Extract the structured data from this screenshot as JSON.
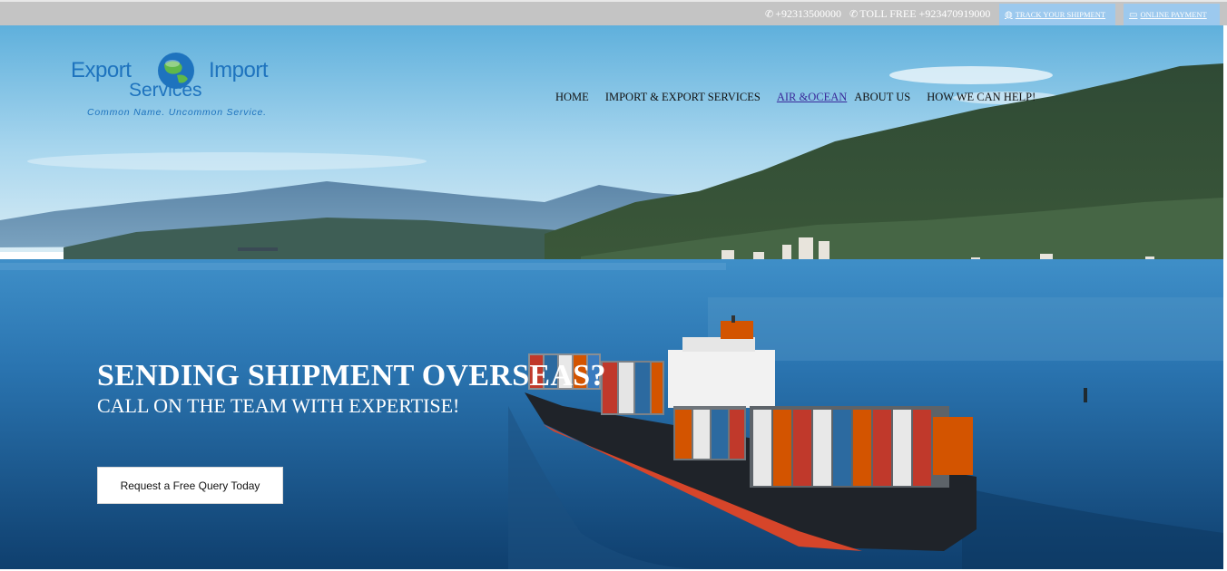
{
  "topbar": {
    "phone1": "+92313500000",
    "phone2": "TOLL FREE +923470919000",
    "track_label": "TRACK YOUR SHIPMENT",
    "payment_label": "ONLINE PAYMENT",
    "bg_color": "#c4c4c4",
    "pill_color": "#9cc9ee"
  },
  "logo": {
    "word1": "Export",
    "word2": "Import",
    "word3": "Services",
    "tagline": "Common Name. Uncommon Service.",
    "brand_color": "#1e73be"
  },
  "nav": {
    "items": [
      {
        "label": "HOME"
      },
      {
        "label": "IMPORT & EXPORT SERVICES"
      },
      {
        "label": "AIR &OCEAN"
      },
      {
        "label": "ABOUT US"
      },
      {
        "label": "HOW WE CAN HELP!"
      }
    ],
    "active_index": 2
  },
  "hero": {
    "headline": "SENDING SHIPMENT OVERSEAS?",
    "subheadline": "CALL ON THE TEAM WITH EXPERTISE!",
    "cta_label": "Request a Free Query Today"
  },
  "icons": {
    "phone": "phone-icon",
    "track": "globe-icon",
    "payment": "card-icon"
  }
}
